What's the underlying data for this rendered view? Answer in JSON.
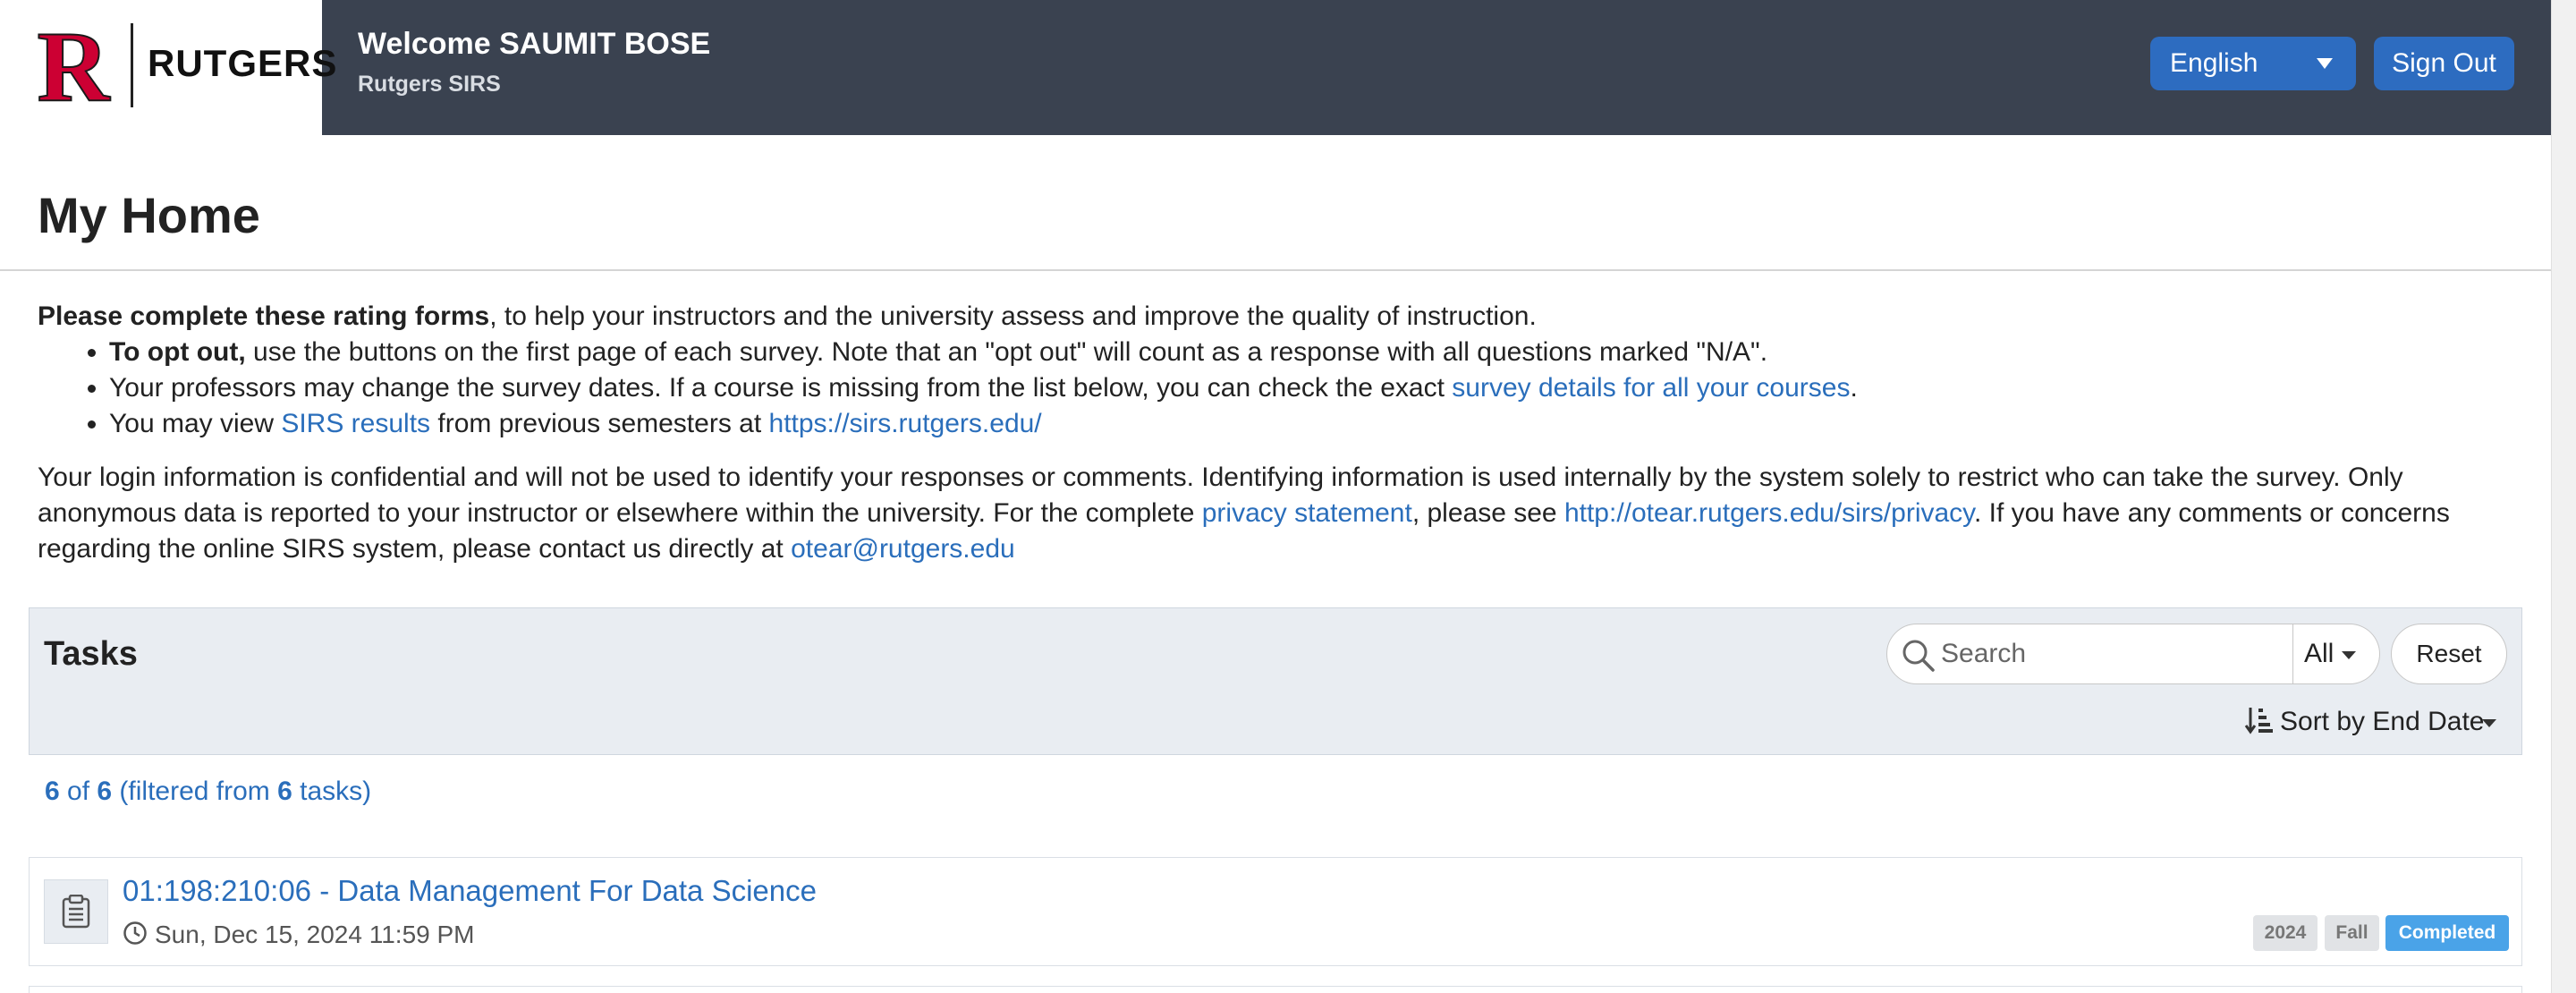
{
  "header": {
    "logo_text": "RUTGERS",
    "logo_letter": "R",
    "welcome": "Welcome SAUMIT BOSE",
    "subtitle": "Rutgers SIRS",
    "language": "English",
    "sign_out": "Sign Out",
    "colors": {
      "bar": "#3a4250",
      "button": "#2d6cc0",
      "logo_red": "#cc0033"
    }
  },
  "page": {
    "title": "My Home"
  },
  "intro": {
    "lead_bold": "Please complete these rating forms",
    "lead_rest": ", to help your instructors and the university assess and improve the quality of instruction.",
    "bullet1_bold": "To opt out,",
    "bullet1_rest": " use the buttons on the first page of each survey. Note that an \"opt out\" will count as a response with all questions marked \"N/A\".",
    "bullet2_text": "Your professors may change the survey dates. If a course is missing from the list below, you can check the exact ",
    "bullet2_link": "survey details for all your courses",
    "bullet2_end": ".",
    "bullet3_pre": "You may view ",
    "bullet3_link": "SIRS results",
    "bullet3_mid": " from previous semesters at ",
    "bullet3_url": "https://sirs.rutgers.edu/",
    "conf_text1": "Your login information is confidential and will not be used to identify your responses or comments. Identifying information is used internally by the system solely to restrict who can take the survey. Only anonymous data is reported to your instructor or elsewhere within the university. For the complete ",
    "conf_link1": "privacy statement",
    "conf_text2": ", please see ",
    "conf_link2": "http://otear.rutgers.edu/sirs/privacy",
    "conf_text3": ". If you have any comments or concerns regarding the online SIRS system, please contact us directly at ",
    "conf_email": "otear@rutgers.edu"
  },
  "tasks": {
    "title": "Tasks",
    "search_placeholder": "Search",
    "filter_value": "All",
    "reset_label": "Reset",
    "sort_label": "Sort by End Date",
    "count": {
      "shown": "6",
      "of_text": " of ",
      "total": "6",
      "filtered_text": " (filtered from ",
      "all": "6",
      "end_text": " tasks)"
    },
    "items": [
      {
        "title": "01:198:210:06 - Data Management For Data Science",
        "date": "Sun, Dec 15, 2024 11:59 PM",
        "year": "2024",
        "term": "Fall",
        "status": "Completed",
        "status_color": "#4aa3e8"
      }
    ]
  }
}
